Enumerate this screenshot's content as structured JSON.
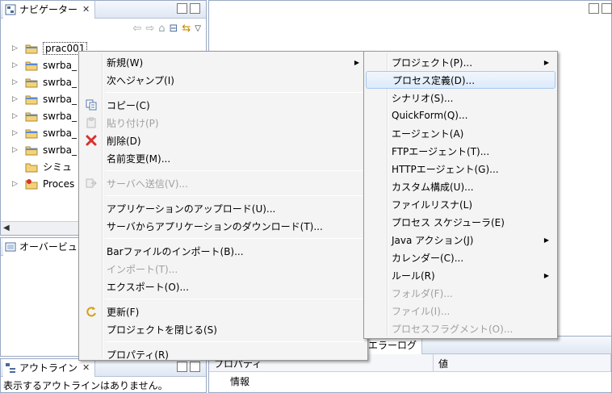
{
  "navigator": {
    "title": "ナビゲーター",
    "items": [
      {
        "label": "prac001",
        "selected": true
      },
      {
        "label": "swrba_"
      },
      {
        "label": "swrba_"
      },
      {
        "label": "swrba_"
      },
      {
        "label": "swrba_"
      },
      {
        "label": "swrba_"
      },
      {
        "label": "swrba_"
      },
      {
        "label": "シミュ"
      },
      {
        "label": "Proces"
      }
    ]
  },
  "overview": {
    "title": "オーバービュ"
  },
  "outline": {
    "title": "アウトライン",
    "message": "表示するアウトラインはありません。"
  },
  "properties": {
    "error_tab": "エラーログ",
    "col_property": "プロパティ",
    "col_value": "値",
    "row_info": "情報"
  },
  "context_menu": {
    "new": "新規(W)",
    "goto": "次へジャンプ(I)",
    "copy": "コピー(C)",
    "paste": "貼り付け(P)",
    "delete": "削除(D)",
    "rename": "名前変更(M)...",
    "send_to_server": "サーバへ送信(V)...",
    "upload_app": "アプリケーションのアップロード(U)...",
    "download_app": "サーバからアプリケーションのダウンロード(T)...",
    "import_bar": "Barファイルのインポート(B)...",
    "import": "インポート(T)...",
    "export": "エクスポート(O)...",
    "refresh": "更新(F)",
    "close_project": "プロジェクトを閉じる(S)",
    "properties": "プロパティ(R)"
  },
  "submenu": {
    "project": "プロジェクト(P)...",
    "process_def": "プロセス定義(D)...",
    "scenario": "シナリオ(S)...",
    "quickform": "QuickForm(Q)...",
    "agent": "エージェント(A)",
    "ftp_agent": "FTPエージェント(T)...",
    "http_agent": "HTTPエージェント(G)...",
    "custom": "カスタム構成(U)...",
    "file_listener": "ファイルリスナ(L)",
    "scheduler": "プロセス スケジューラ(E)",
    "java_action": "Java アクション(J)",
    "calendar": "カレンダー(C)...",
    "rule": "ルール(R)",
    "folder": "フォルダ(F)...",
    "file": "ファイル(I)...",
    "fragment": "プロセスフラグメント(O)..."
  },
  "colors": {
    "highlight": "#dceafb",
    "disabled": "#a0a0a0",
    "delete_icon": "#d9302c"
  }
}
